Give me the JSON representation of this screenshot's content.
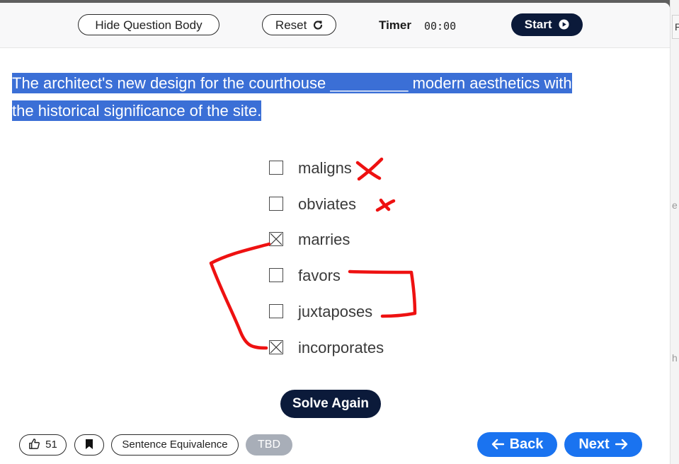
{
  "toolbar": {
    "hide_body_label": "Hide Question Body",
    "reset_label": "Reset",
    "timer_label": "Timer",
    "timer_value": "00:00",
    "start_label": "Start"
  },
  "question": {
    "text_line1": "The architect's new design for the courthouse _________ modern aesthetics with",
    "text_line2": "the historical significance of the site."
  },
  "choices": [
    {
      "label": "maligns",
      "checked": false
    },
    {
      "label": "obviates",
      "checked": false
    },
    {
      "label": "marries",
      "checked": true
    },
    {
      "label": "favors",
      "checked": false
    },
    {
      "label": "juxtaposes",
      "checked": false
    },
    {
      "label": "incorporates",
      "checked": true
    }
  ],
  "solve_again_label": "Solve Again",
  "footer": {
    "likes_count": "51",
    "category_label": "Sentence Equivalence",
    "status_label": "TBD",
    "back_label": "Back",
    "next_label": "Next"
  },
  "right_strip": {
    "box_letter": "P",
    "frag1": "e",
    "frag2": "h"
  },
  "colors": {
    "highlight": "#3b6fd6",
    "dark_button": "#0b1a3a",
    "nav_blue": "#1a73f0",
    "annotation_red": "#ee1111"
  }
}
